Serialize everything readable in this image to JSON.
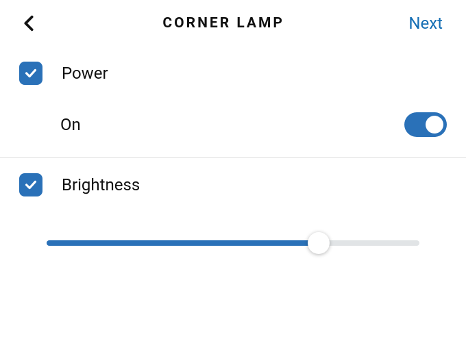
{
  "header": {
    "title": "CORNER LAMP",
    "next_label": "Next"
  },
  "sections": {
    "power": {
      "label": "Power",
      "checked": true,
      "state_label": "On",
      "state_on": true
    },
    "brightness": {
      "label": "Brightness",
      "checked": true,
      "value_percent": 73
    }
  },
  "colors": {
    "accent": "#2a71b8",
    "link": "#146eb4"
  }
}
